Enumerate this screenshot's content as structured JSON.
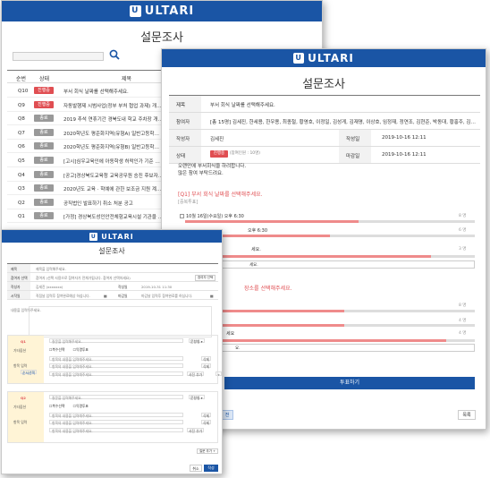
{
  "brand": "ULTARI",
  "brand_mark": "U",
  "page_title": "설문조사",
  "list_window": {
    "columns": [
      "순번",
      "상태",
      "제목"
    ],
    "rows": [
      {
        "no": "Q10",
        "status": "진행중",
        "status_type": "active",
        "title": "부서 회식 날짜를 선택해주세요."
      },
      {
        "no": "Q9",
        "status": "진행중",
        "status_type": "active",
        "title": "자동발행제 시범사업(정부 부처 협업 과제) 개발 수요조사"
      },
      {
        "no": "Q8",
        "status": "종료",
        "status_type": "closed",
        "title": "2019 추석 연휴기간 경북도내 학교 주차장 개방 안내"
      },
      {
        "no": "Q7",
        "status": "종료",
        "status_type": "closed",
        "title": "2020학년도 평준화지역(유형A) 일반고등학교 입학"
      },
      {
        "no": "Q6",
        "status": "종료",
        "status_type": "closed",
        "title": "2020학년도 평준화지역(유형B) 일반고등학교 입학"
      },
      {
        "no": "Q5",
        "status": "종료",
        "status_type": "closed",
        "title": "[고시]심우교육인에 아동학생 허락인가 기준 및 이던"
      },
      {
        "no": "Q4",
        "status": "종료",
        "status_type": "closed",
        "title": "[공고]경상북도교육청 교육공무원 승진 후보자 가산"
      },
      {
        "no": "Q3",
        "status": "종료",
        "status_type": "closed",
        "title": "2020년도 교육 · 학예에 관한 보조금 지원 계획 공고"
      },
      {
        "no": "Q2",
        "status": "종료",
        "status_type": "closed",
        "title": "공직법인 발표하기 취소 처분 공고"
      },
      {
        "no": "Q1",
        "status": "종료",
        "status_type": "closed",
        "title": "[가정] 경상북도성인안전체험교육시설 기관을 공모진"
      }
    ]
  },
  "detail_window": {
    "info": {
      "title_label": "제목",
      "title_value": "부서 회식 날짜를 선택해주세요.",
      "participants_label": "참여자",
      "participants_value": "[총 15명] 김세진, 한세용, 한우용, 최종철, 황영호, 이정일, 김성게, 김재명, 이상호, 임정재, 정연조, 김현준, 박동대, 황홍주, 김진지",
      "author_label": "작성자",
      "author_value": "김세진",
      "created_label": "작성일",
      "created_value": "2019-10-16 12:11",
      "status_label": "상태",
      "status_badge": "진행중",
      "status_note": "(참여인원 : 10명)",
      "deadline_label": "마감일",
      "deadline_value": "2019-10-16 12:11"
    },
    "notice_line1": "오랜만에 부서회식을 하려합니다.",
    "notice_line2": "많은 참여 부탁드려요.",
    "q1": {
      "title": "[Q1] 부서 회식 날짜를 선택해주세요.",
      "sub": "[중복투표]",
      "opt1": "10월 16일(수요일) 오후 6:30",
      "opt2": "오후 6:30",
      "opt3_tail": "세요.",
      "ans_tail": "세요.",
      "c1": "8 명",
      "c2": "6 명",
      "c3": "3 명",
      "f1": 0.6,
      "f2": 0.5,
      "f3": 0.85
    },
    "q2": {
      "title_tail": "장소를 선택해주세요.",
      "opt_tail": "세요",
      "ans_tail": "요.",
      "c1": "8 명",
      "c2": "4 명",
      "c3": "4 명",
      "f1": 0.55,
      "f2": 0.55,
      "f3": 0.9
    },
    "vote_button": "투표하기",
    "list_button": "목록",
    "back_button_tail": "전"
  },
  "form_window": {
    "rows": [
      {
        "label": "제목",
        "value": "제목을 입력해주세요."
      },
      {
        "label": "참여자 선택",
        "value": "참여자 (선택 사용으로 참여자가 전체가됩니다. 참여자 선택하세요)",
        "button": "참여자 선택"
      },
      {
        "label": "작성자",
        "value": "김세진 (xxxxxxx)",
        "label2": "작성일",
        "value2": "2019-10-31 11:30"
      },
      {
        "label": "시작일",
        "value": "직접날 입력후 참여완료예상 하십니다.",
        "label2": "마감일",
        "value2": "마감날 입력후 참여완료를 하십니다."
      }
    ],
    "content_placeholder": "내용을 입력해주세요.",
    "q1": {
      "num": "Q1",
      "question": "질문을 입력해주세요.",
      "type": "문항형 ▾",
      "options_label": "기타옵션",
      "opt_a": "복수선택",
      "opt_b": "익명투표",
      "items_label": "항목 입력",
      "item": "항목의 내용을 입력해주세요.",
      "del": "삭제",
      "add": "+",
      "order": "순서선택",
      "image": "사진 추가"
    },
    "q2": {
      "num": "Q2",
      "question": "질문을 입력해주세요.",
      "type": "문항형 ▾",
      "options_label": "기타옵션",
      "opt_a": "복수선택",
      "opt_b": "익명투표",
      "items_label": "항목 입력",
      "item": "항목의 내용을 입력해주세요.",
      "del": "삭제",
      "image": "사진 추가"
    },
    "add_question": "질문 추가 +",
    "cancel_button": "취소",
    "save_button": "작성"
  },
  "colors": {
    "brand": "#1a55a5",
    "active": "#e04e52",
    "closed": "#999999",
    "bar": "#ef8b8b"
  }
}
